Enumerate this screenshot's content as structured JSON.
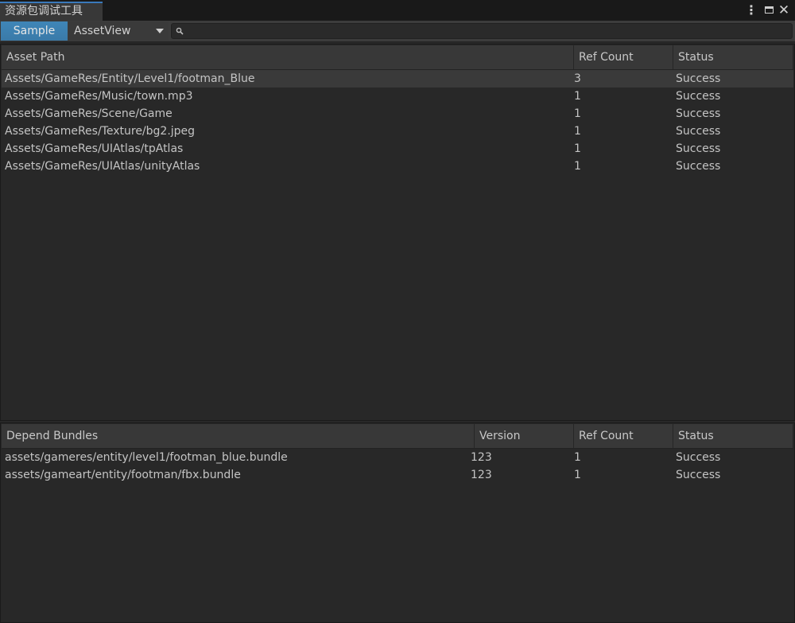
{
  "window": {
    "title": "资源包调试工具"
  },
  "toolbar": {
    "sample_label": "Sample",
    "view_select": "AssetView",
    "search_value": ""
  },
  "asset_table": {
    "columns": [
      "Asset Path",
      "Ref Count",
      "Status"
    ],
    "rows": [
      {
        "path": "Assets/GameRes/Entity/Level1/footman_Blue",
        "ref_count": "3",
        "status": "Success"
      },
      {
        "path": "Assets/GameRes/Music/town.mp3",
        "ref_count": "1",
        "status": "Success"
      },
      {
        "path": "Assets/GameRes/Scene/Game",
        "ref_count": "1",
        "status": "Success"
      },
      {
        "path": "Assets/GameRes/Texture/bg2.jpeg",
        "ref_count": "1",
        "status": "Success"
      },
      {
        "path": "Assets/GameRes/UIAtlas/tpAtlas",
        "ref_count": "1",
        "status": "Success"
      },
      {
        "path": "Assets/GameRes/UIAtlas/unityAtlas",
        "ref_count": "1",
        "status": "Success"
      }
    ]
  },
  "bundle_table": {
    "columns": [
      "Depend Bundles",
      "Version",
      "Ref Count",
      "Status"
    ],
    "rows": [
      {
        "bundle": "assets/gameres/entity/level1/footman_blue.bundle",
        "version": "123",
        "ref_count": "1",
        "status": "Success"
      },
      {
        "bundle": "assets/gameart/entity/footman/fbx.bundle",
        "version": "123",
        "ref_count": "1",
        "status": "Success"
      }
    ]
  },
  "icons": {
    "menu": "kebab-menu-icon",
    "maximize": "maximize-icon",
    "close": "close-icon",
    "search": "search-icon",
    "dropdown": "chevron-down-icon"
  },
  "colors": {
    "accent": "#3a7aa8",
    "background": "#282828",
    "header": "#383838"
  }
}
